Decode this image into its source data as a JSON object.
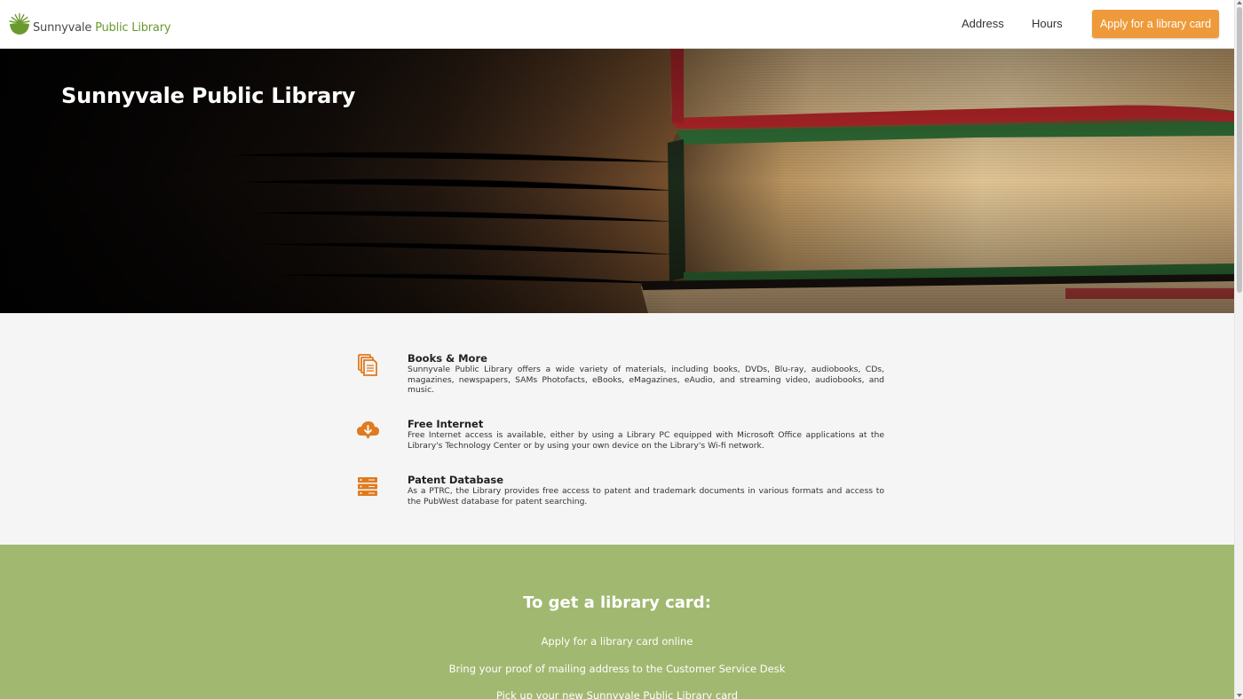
{
  "header": {
    "logo": {
      "name_part1": "Sunnyvale",
      "name_part2": "Public Library",
      "icon": "sunrise-logo-icon"
    },
    "nav": [
      {
        "label": "Address"
      },
      {
        "label": "Hours"
      }
    ],
    "apply_button": "Apply for a library card"
  },
  "hero": {
    "title": "Sunnyvale Public Library",
    "image": "stack-of-books-photo"
  },
  "features": [
    {
      "icon": "documents-icon",
      "title": "Books & More",
      "description": "Sunnyvale Public Library offers a wide variety of materials, including books, DVDs, Blu-ray, audiobooks, CDs, magazines, newspapers, SAMs Photofacts, eBooks, eMagazines, eAudio, and streaming video, audiobooks, and music."
    },
    {
      "icon": "cloud-download-icon",
      "title": "Free Internet",
      "description": "Free Internet access is available, either by using a Library PC equipped with Microsoft Office applications at the Library's Technology Center or by using your own device on the Library's Wi-fi network."
    },
    {
      "icon": "database-server-icon",
      "title": "Patent Database",
      "description": "As a PTRC, the Library provides free access to patent and trademark documents in various formats and access to the PubWest database for patent searching."
    }
  ],
  "library_card": {
    "heading": "To get a library card:",
    "steps": [
      "Apply for a library card online",
      "Bring your proof of mailing address to the Customer Service Desk",
      "Pick up your new Sunnyvale Public Library card"
    ]
  },
  "colors": {
    "accent_orange": "#ef9a3a",
    "icon_orange": "#e07a1f",
    "brand_green": "#6a9a2e",
    "section_green": "#a1b870",
    "features_bg": "#f5f5f5"
  }
}
